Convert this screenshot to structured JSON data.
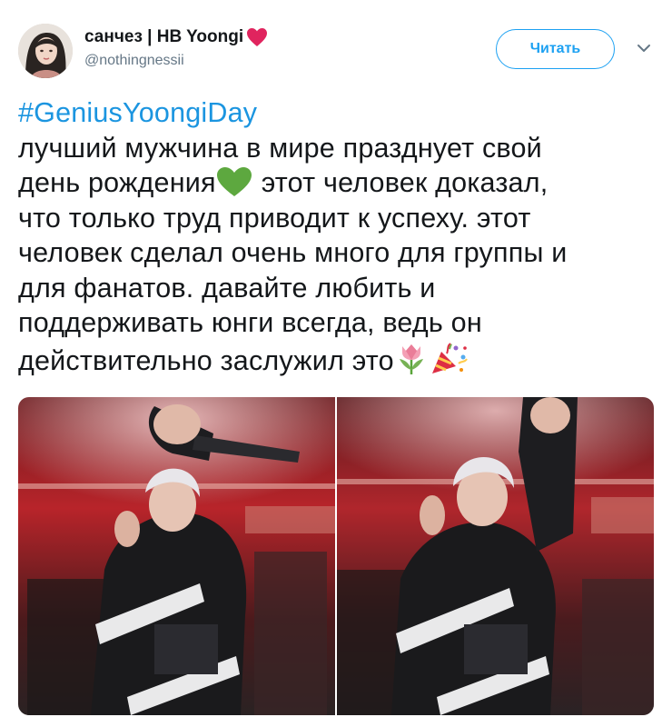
{
  "header": {
    "display_name": "санчез | HB Yoongi",
    "handle": "@nothingnessii",
    "follow_label": "Читать",
    "icons": [
      "avatar",
      "red-heart-icon",
      "chevron-down-icon"
    ]
  },
  "tweet": {
    "hashtag": "#GeniusYoongiDay",
    "lines": [
      "лучший мужчина в мире празднует свой",
      "день рождения",
      "этот человек доказал,",
      "что только труд приводит к успеху. этот",
      "человек сделал очень много для группы и",
      "для фанатов. давайте любить и",
      "поддерживать юнги всегда, ведь он",
      "действительно заслужил это"
    ],
    "emojis": [
      "green-heart-emoji",
      "tulip-emoji",
      "party-popper-emoji"
    ]
  },
  "media": {
    "photos": [
      "concert-photo-1",
      "concert-photo-2"
    ]
  },
  "colors": {
    "link": "#1b95e0",
    "accent": "#1da1f2",
    "text": "#14171a",
    "muted": "#657786",
    "heart": "#e0245e",
    "green_heart": "#5da83f"
  }
}
